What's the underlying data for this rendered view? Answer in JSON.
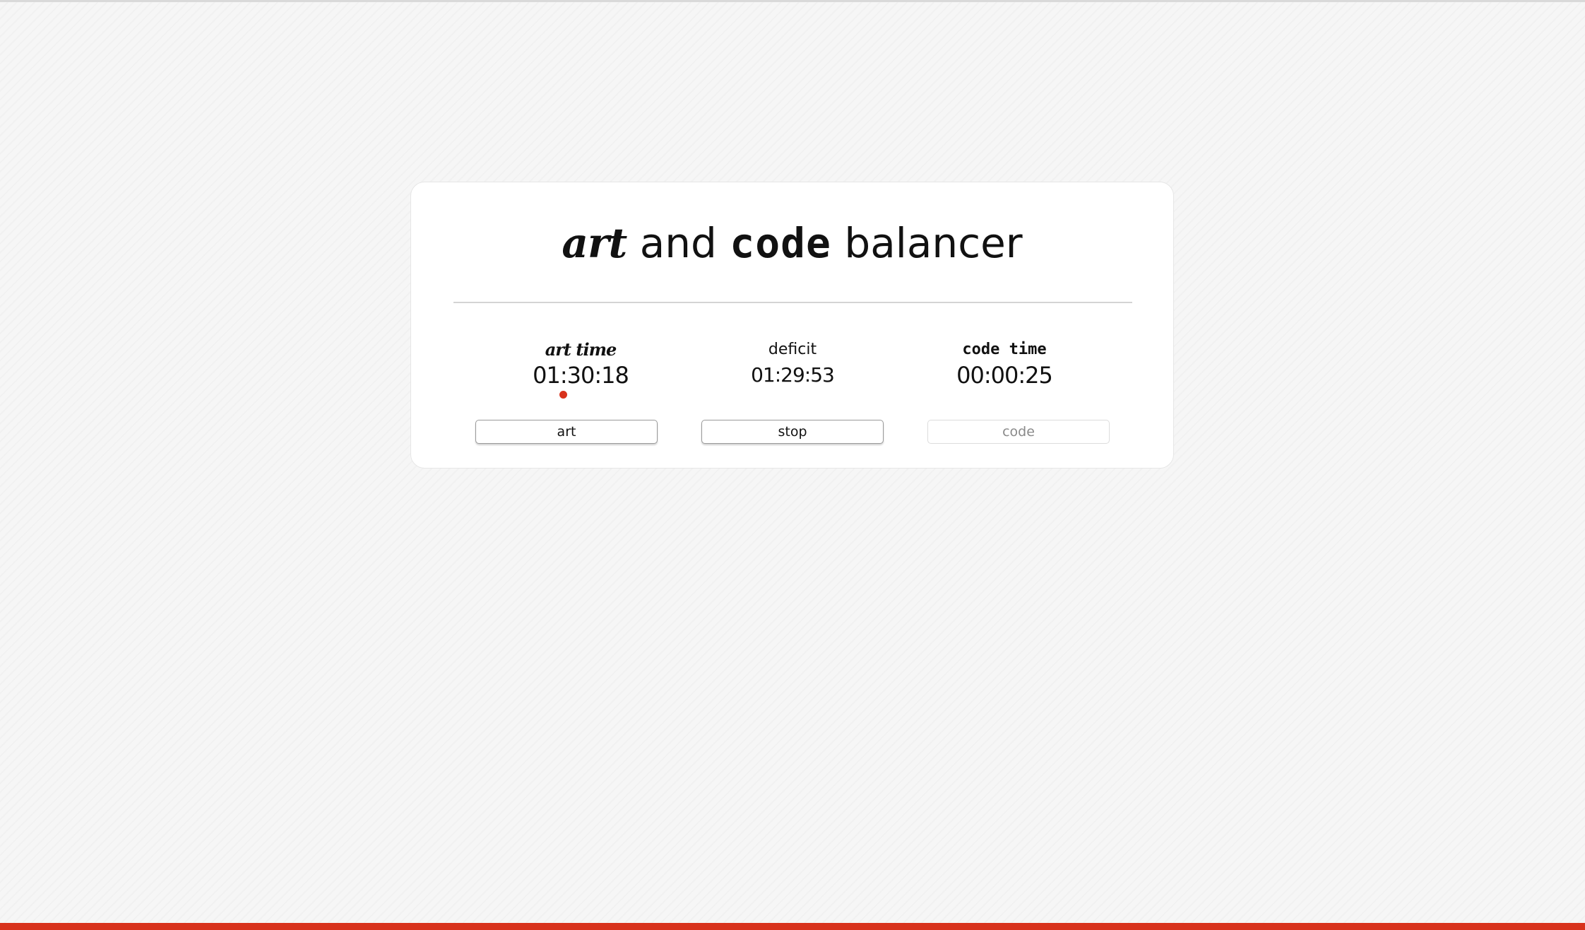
{
  "app": {
    "title_art": "art",
    "title_and": "and",
    "title_code": "code",
    "title_balancer": "balancer"
  },
  "timers": {
    "art": {
      "label": "art time",
      "value": "01:30:18",
      "active": true
    },
    "deficit": {
      "label": "deficit",
      "value": "01:29:53"
    },
    "code": {
      "label": "code time",
      "value": "00:00:25",
      "active": false
    }
  },
  "buttons": {
    "art_label": "art",
    "stop_label": "stop",
    "code_label": "code"
  },
  "colors": {
    "accent": "#d8321c",
    "text": "#111111",
    "disabled_text": "#8a8a8a"
  }
}
